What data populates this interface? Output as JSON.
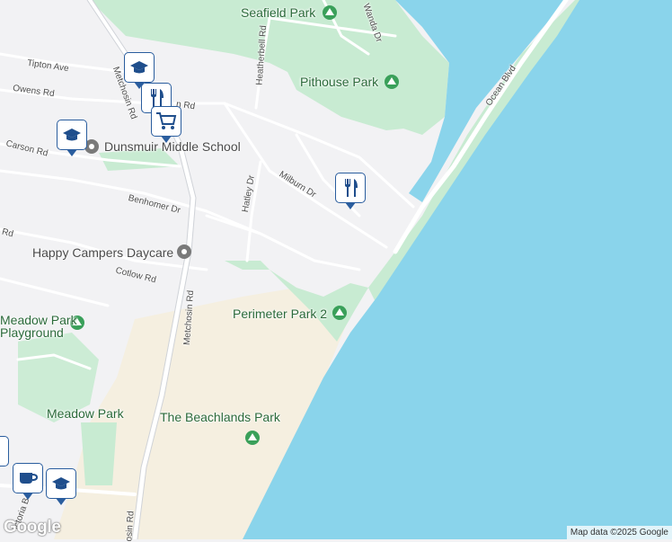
{
  "parks": [
    {
      "name": "Seafield Park"
    },
    {
      "name": "Pithouse Park"
    },
    {
      "name": "Perimeter Park 2"
    },
    {
      "name": "The Beachlands Park"
    },
    {
      "name": "Meadow Park"
    },
    {
      "name": "Meadow Park\nPlayground"
    }
  ],
  "places": {
    "school": "Dunsmuir Middle School",
    "daycare": "Happy Campers Daycare"
  },
  "roads": {
    "tipton": "Tipton Ave",
    "owens": "Owens Rd",
    "carson": "Carson Rd",
    "benhomer": "Benhomer Dr",
    "cotlow": "Cotlow Rd",
    "heatherbell": "Heatherbell Rd",
    "milburn": "Milburn Dr",
    "hatley": "Hatley Dr",
    "metchosin_upper": "Metchosin Rd",
    "metchosin_lower": "Metchosin Rd",
    "metchosin_bottom": "osin Rd",
    "ocean": "Ocean Blvd",
    "wanda": "Wanda Dr",
    "victoria": "ictoria B",
    "rd_left": "Rd",
    "rd_top": "n Rd"
  },
  "markers": [
    {
      "type": "school-icon"
    },
    {
      "type": "school-icon"
    },
    {
      "type": "restaurant-icon"
    },
    {
      "type": "shopping-cart-icon"
    },
    {
      "type": "restaurant-icon"
    },
    {
      "type": "school-icon"
    },
    {
      "type": "coffee-icon"
    },
    {
      "type": "generic-icon"
    }
  ],
  "attribution": "Map data ©2025 Google",
  "logo": "Google",
  "colors": {
    "water": "#8ad4eb",
    "park": "#c8ebd2",
    "sand": "#f5efe0",
    "road": "#ffffff",
    "marker_border": "#2a5d9e"
  }
}
